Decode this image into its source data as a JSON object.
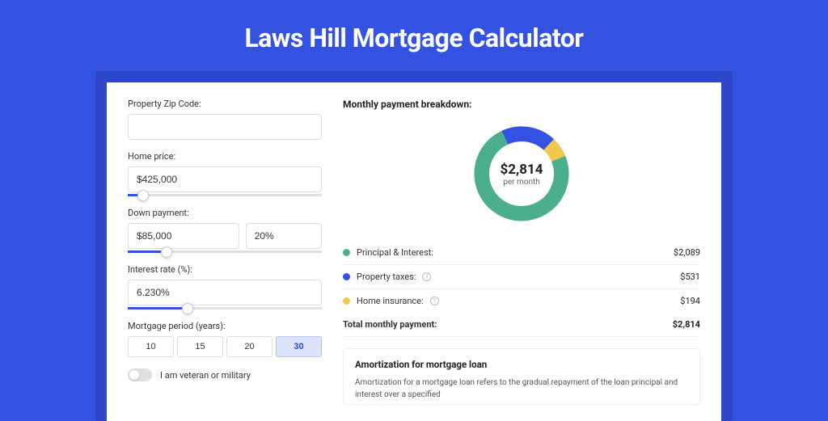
{
  "title": "Laws Hill Mortgage Calculator",
  "form": {
    "zip_label": "Property Zip Code:",
    "zip_value": "",
    "home_price_label": "Home price:",
    "home_price_value": "$425,000",
    "home_price_slider_pct": 8,
    "down_payment_label": "Down payment:",
    "down_payment_value": "$85,000",
    "down_payment_pct_value": "20%",
    "down_payment_slider_pct": 20,
    "interest_label": "Interest rate (%):",
    "interest_value": "6.230%",
    "interest_slider_pct": 31,
    "period_label": "Mortgage period (years):",
    "periods": [
      "10",
      "15",
      "20",
      "30"
    ],
    "period_selected": "30",
    "veteran_label": "I am veteran or military",
    "veteran_on": false
  },
  "breakdown": {
    "title": "Monthly payment breakdown:",
    "center_value": "$2,814",
    "center_sub": "per month",
    "items": [
      {
        "label": "Principal & Interest:",
        "amount": "$2,089",
        "color": "#4aaf8a",
        "has_info": false
      },
      {
        "label": "Property taxes:",
        "amount": "$531",
        "color": "#3452e1",
        "has_info": true
      },
      {
        "label": "Home insurance:",
        "amount": "$194",
        "color": "#f2c94c",
        "has_info": true
      }
    ],
    "total_label": "Total monthly payment:",
    "total_amount": "$2,814"
  },
  "amortization": {
    "title": "Amortization for mortgage loan",
    "text": "Amortization for a mortgage loan refers to the gradual repayment of the loan principal and interest over a specified"
  },
  "chart_data": {
    "type": "pie",
    "title": "Monthly payment breakdown",
    "series": [
      {
        "name": "Principal & Interest",
        "value": 2089,
        "color": "#4aaf8a"
      },
      {
        "name": "Property taxes",
        "value": 531,
        "color": "#3452e1"
      },
      {
        "name": "Home insurance",
        "value": 194,
        "color": "#f2c94c"
      }
    ],
    "total": 2814,
    "center_label": "$2,814 per month"
  }
}
